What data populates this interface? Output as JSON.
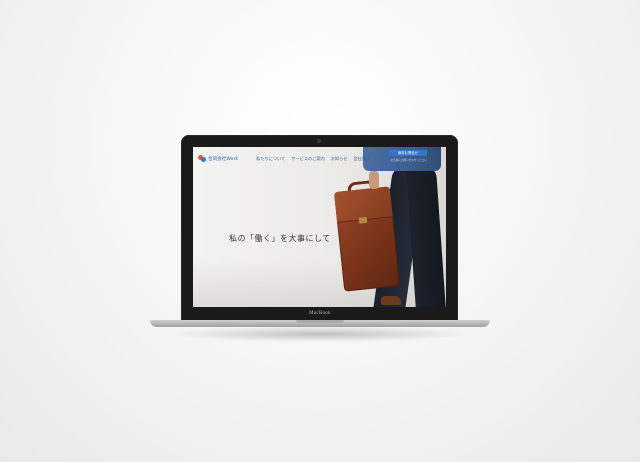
{
  "laptop": {
    "brand": "MacBook"
  },
  "website": {
    "logo_text": "合同会社Work",
    "nav": [
      "私たちについて",
      "サービスのご案内",
      "お知らせ",
      "会社案内"
    ],
    "cta_label": "無料お問合せ",
    "cta_sub": "お気軽にお問い合わせください",
    "hero_text": "私の「働く」を大事にして"
  },
  "colors": {
    "brand_blue": "#2a63a8",
    "cta_blue": "#3b72c6",
    "logo_orange": "#e05a2b"
  }
}
